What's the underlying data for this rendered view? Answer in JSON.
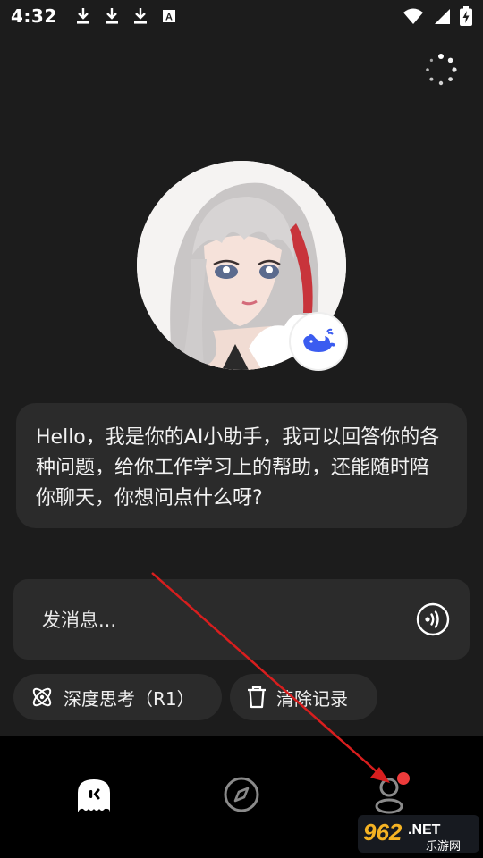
{
  "status_bar": {
    "time": "4:32",
    "download_icons": [
      "download-icon",
      "download-icon",
      "download-icon"
    ],
    "a_icon": "a-text-icon",
    "wifi_icon": "wifi-icon",
    "signal_icon": "signal-icon",
    "battery_icon": "battery-charging-icon"
  },
  "header": {
    "loading_icon": "loading-dots-icon"
  },
  "assistant": {
    "avatar": "assistant-avatar",
    "badge_icon": "whale-icon",
    "greeting": "Hello，我是你的AI小助手，我可以回答你的各种问题，给你工作学习上的帮助，还能随时陪你聊天，你想问点什么呀?"
  },
  "composer": {
    "placeholder": "发消息...",
    "voice_icon": "voice-call-icon"
  },
  "chips": {
    "deep_think": "深度思考（R1）",
    "clear_history": "清除记录",
    "deep_think_icon": "atom-icon",
    "clear_history_icon": "trash-icon"
  },
  "bottom_nav": {
    "items": [
      {
        "name": "chat",
        "icon": "chat-ghost-icon"
      },
      {
        "name": "discover",
        "icon": "compass-icon"
      },
      {
        "name": "profile",
        "icon": "profile-icon",
        "has_badge": true
      }
    ],
    "active_color": "#ffffff",
    "inactive_color": "#8a8a8a",
    "badge_color": "#ee3b3b"
  },
  "watermark": {
    "brand": "962",
    "suffix": ".NET",
    "subtitle": "乐游网"
  },
  "colors": {
    "background": "#1c1c1c",
    "card": "#2b2b2b",
    "nav_background": "#000000",
    "annotation_arrow": "#d81e1e",
    "badge_blue": "#3b5cf0"
  }
}
